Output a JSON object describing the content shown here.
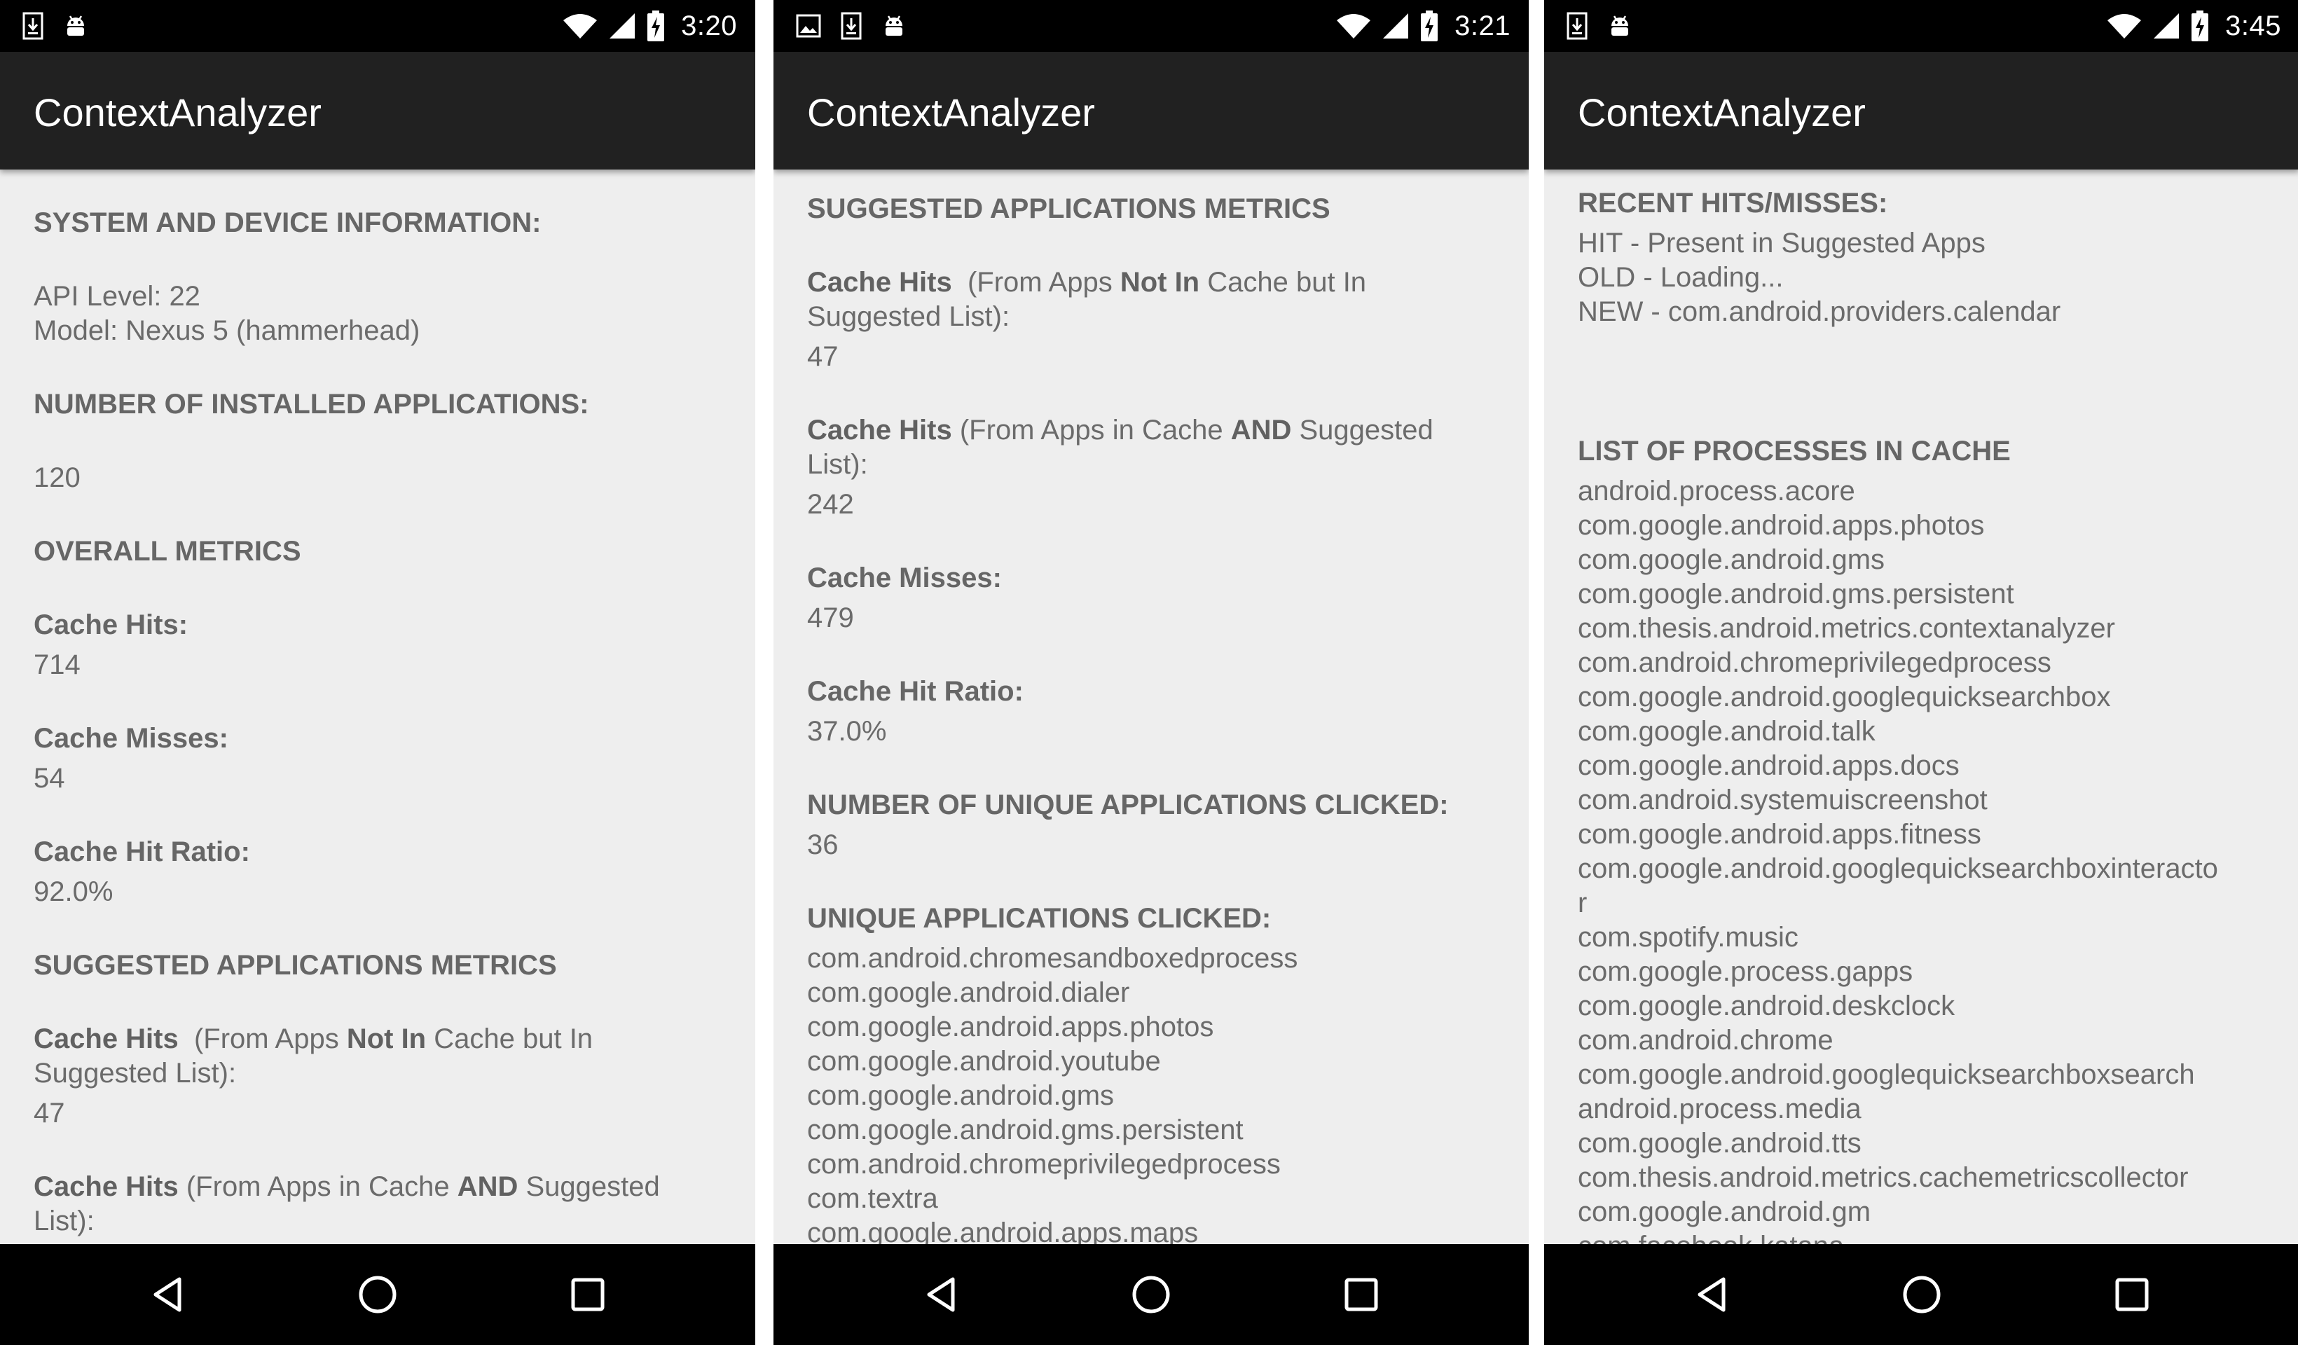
{
  "screens": [
    {
      "status": {
        "time": "3:20",
        "left_icons": [
          "download-icon",
          "android-debug-icon"
        ],
        "right_icons": [
          "wifi-icon",
          "cell-signal-icon",
          "battery-charging-icon"
        ]
      },
      "appbar": {
        "title": "ContextAnalyzer"
      },
      "content": {
        "system_heading": "SYSTEM AND DEVICE INFORMATION:",
        "api_level": "API Level: 22",
        "model": "Model: Nexus 5 (hammerhead)",
        "installed_heading": "NUMBER OF INSTALLED APPLICATIONS:",
        "installed_count": "120",
        "overall_heading": "OVERALL METRICS",
        "cache_hits_label": "Cache Hits:",
        "cache_hits_value": "714",
        "cache_misses_label": "Cache Misses:",
        "cache_misses_value": "54",
        "hit_ratio_label": "Cache Hit Ratio:",
        "hit_ratio_value": "92.0%",
        "suggested_heading": "SUGGESTED APPLICATIONS METRICS",
        "hits_not_in_cache": {
          "label": "Cache Hits",
          "pre": "  (From Apps ",
          "bold": "Not In",
          "post": " Cache but In Suggested List):",
          "value": "47"
        },
        "hits_in_cache": {
          "label": "Cache Hits",
          "pre": " (From Apps in Cache ",
          "bold": "AND",
          "post": " Suggested List):"
        }
      }
    },
    {
      "status": {
        "time": "3:21",
        "left_icons": [
          "image-icon",
          "download-icon",
          "android-debug-icon"
        ],
        "right_icons": [
          "wifi-icon",
          "cell-signal-icon",
          "battery-charging-icon"
        ]
      },
      "appbar": {
        "title": "ContextAnalyzer"
      },
      "content": {
        "suggested_heading": "SUGGESTED APPLICATIONS METRICS",
        "hits_not_in_cache": {
          "label": "Cache Hits",
          "pre": "  (From Apps ",
          "bold": "Not In",
          "post": " Cache but In Suggested List):",
          "value": "47"
        },
        "hits_in_cache": {
          "label": "Cache Hits",
          "pre": " (From Apps in Cache ",
          "bold": "AND",
          "post": " Suggested List):",
          "value": "242"
        },
        "cache_misses_label": "Cache Misses:",
        "cache_misses_value": "479",
        "hit_ratio_label": "Cache Hit Ratio:",
        "hit_ratio_value": "37.0%",
        "unique_count_heading": "NUMBER OF UNIQUE APPLICATIONS CLICKED:",
        "unique_count_value": "36",
        "unique_list_heading": "UNIQUE APPLICATIONS CLICKED:",
        "unique_apps": [
          "com.android.chromesandboxedprocess",
          "com.google.android.dialer",
          "com.google.android.apps.photos",
          "com.google.android.youtube",
          "com.google.android.gms",
          "com.google.android.gms.persistent",
          "com.android.chromeprivilegedprocess",
          "com.textra",
          "com.google.android.apps.maps"
        ]
      }
    },
    {
      "status": {
        "time": "3:45",
        "left_icons": [
          "download-icon",
          "android-debug-icon"
        ],
        "right_icons": [
          "wifi-icon",
          "cell-signal-icon",
          "battery-charging-icon"
        ]
      },
      "appbar": {
        "title": "ContextAnalyzer"
      },
      "content": {
        "recent_heading": "RECENT HITS/MISSES:",
        "recent_items": [
          "HIT - Present in Suggested Apps",
          "OLD - Loading...",
          "NEW - com.android.providers.calendar"
        ],
        "processes_heading": "LIST OF PROCESSES IN CACHE",
        "processes": [
          "android.process.acore",
          "com.google.android.apps.photos",
          "com.google.android.gms",
          "com.google.android.gms.persistent",
          "com.thesis.android.metrics.contextanalyzer",
          "com.android.chromeprivilegedprocess",
          "com.google.android.googlequicksearchbox",
          "com.google.android.talk",
          "com.google.android.apps.docs",
          "com.android.systemuiscreenshot",
          "com.google.android.apps.fitness",
          "com.google.android.googlequicksearchboxinteracto",
          "r",
          "com.spotify.music",
          "com.google.process.gapps",
          "com.google.android.deskclock",
          "com.android.chrome",
          "com.google.android.googlequicksearchboxsearch",
          "android.process.media",
          "com.google.android.tts",
          "com.thesis.android.metrics.cachemetricscollector",
          "com.google.android.gm",
          "com.facebook.katana"
        ]
      }
    }
  ],
  "navbar": {
    "back": "back-icon",
    "home": "home-icon",
    "recents": "recents-icon"
  }
}
